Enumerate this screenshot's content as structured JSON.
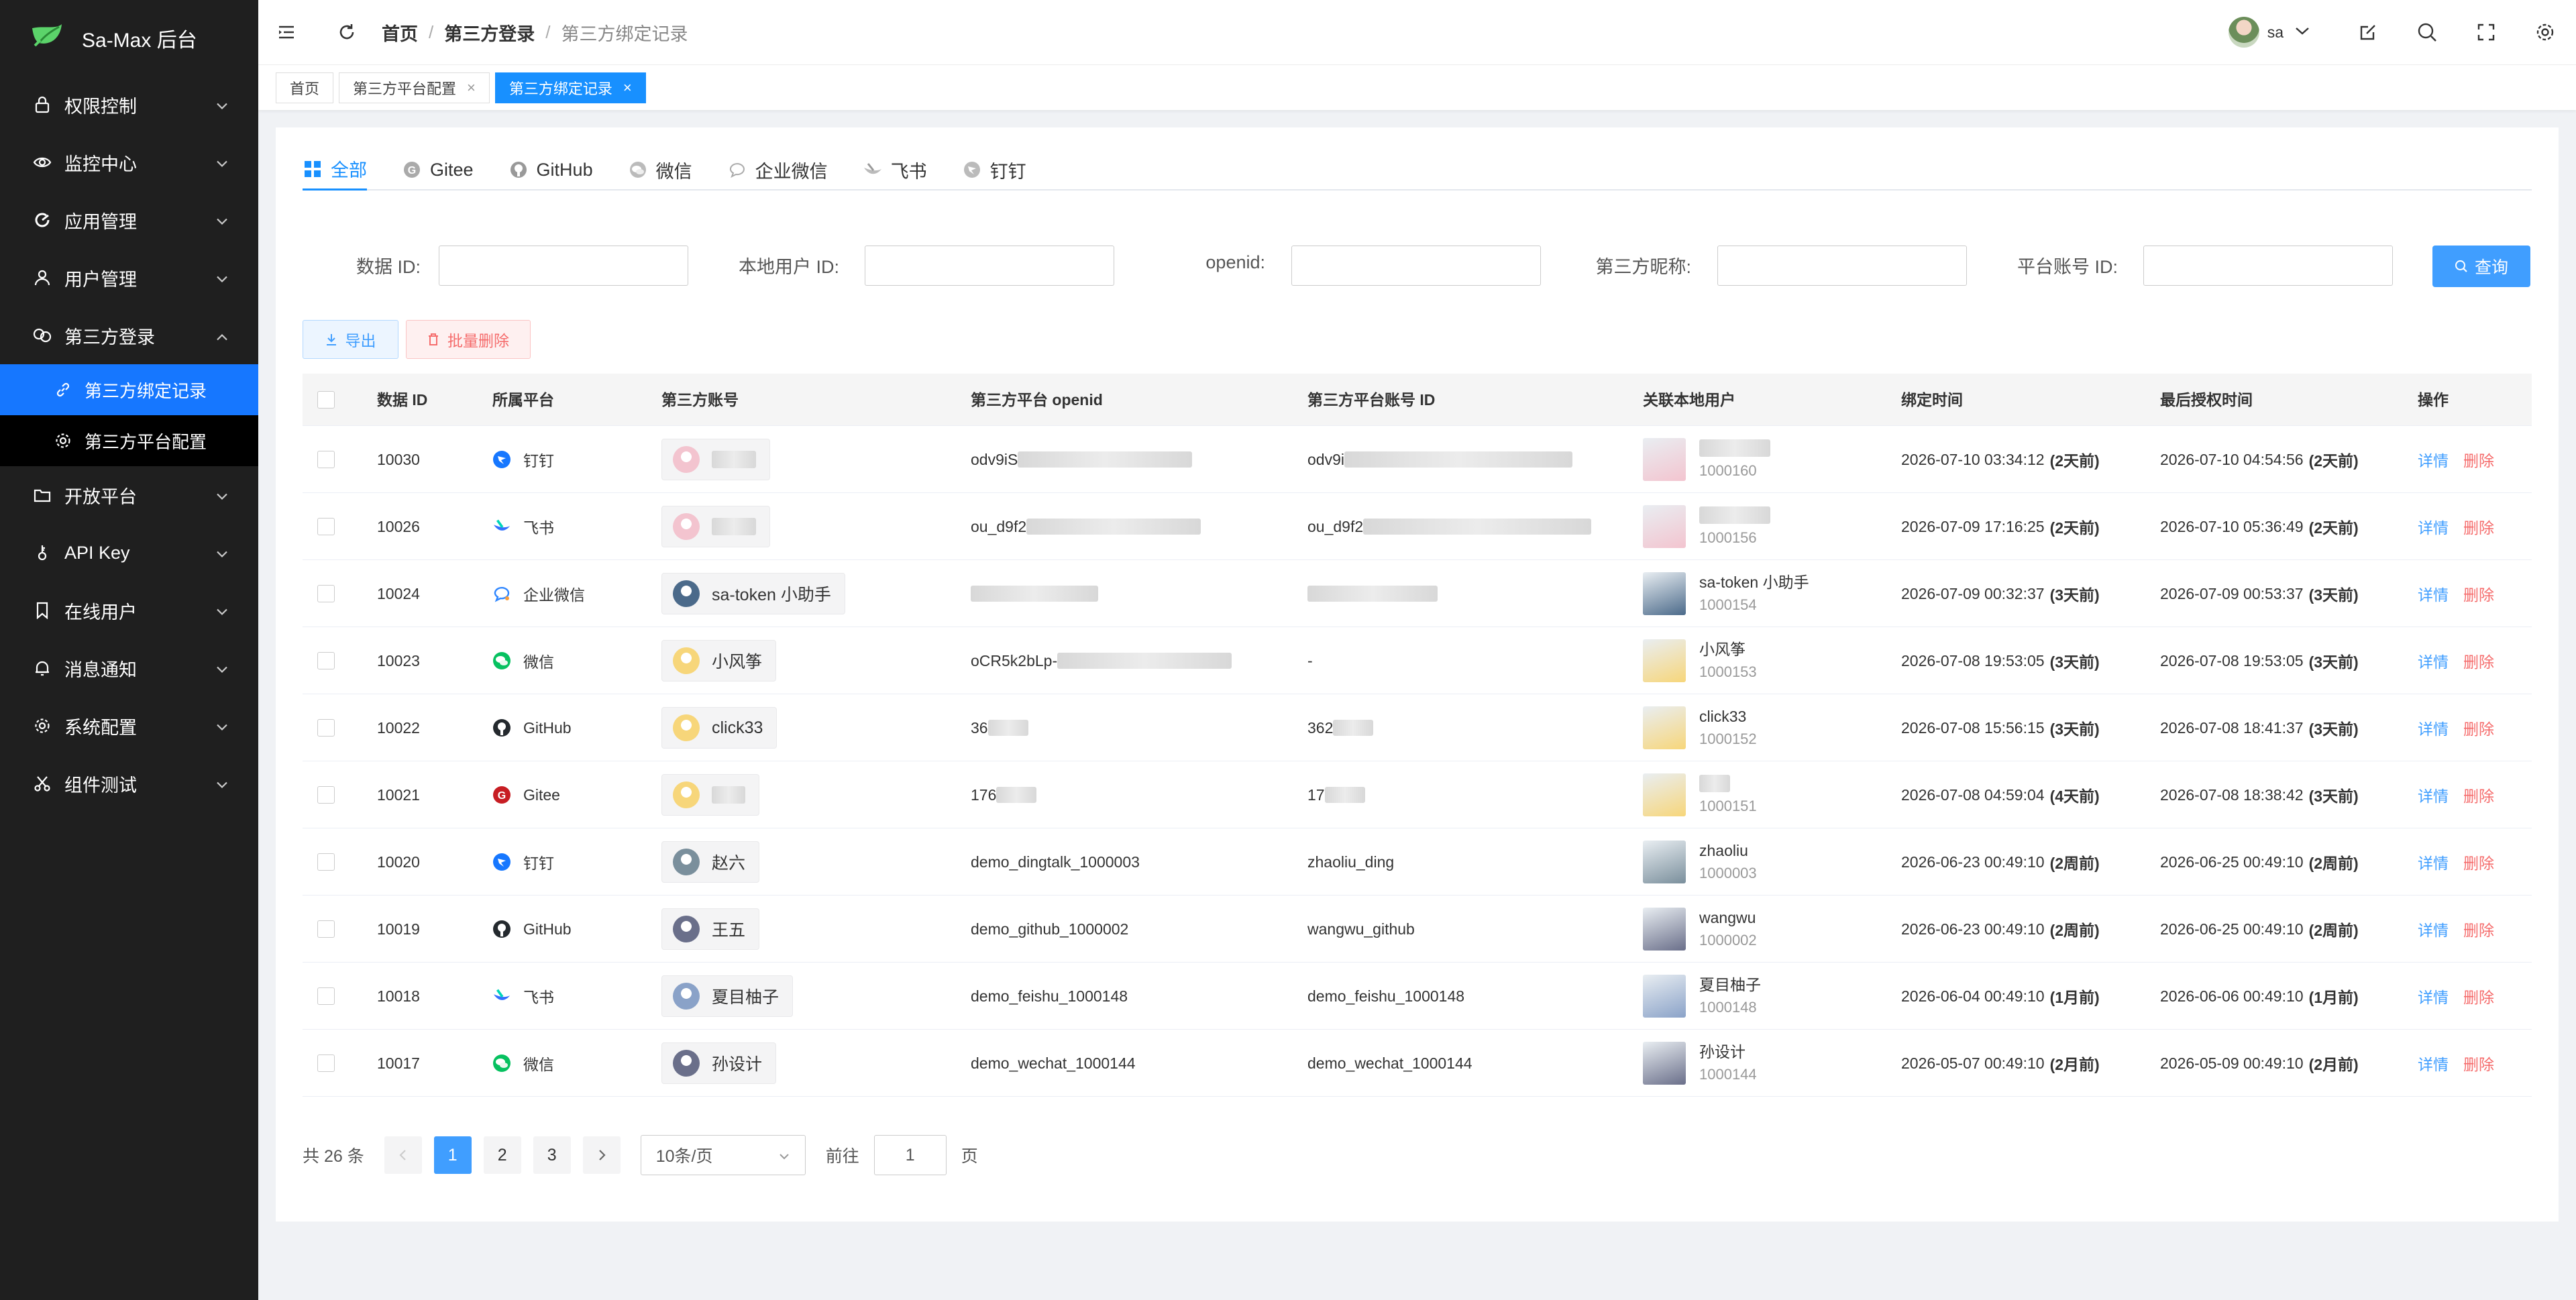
{
  "app": {
    "title": "Sa-Max 后台"
  },
  "sidebar": {
    "items": [
      {
        "label": "权限控制",
        "icon": "lock-icon"
      },
      {
        "label": "监控中心",
        "icon": "eye-icon"
      },
      {
        "label": "应用管理",
        "icon": "refresh-circle-icon"
      },
      {
        "label": "用户管理",
        "icon": "user-icon"
      },
      {
        "label": "第三方登录",
        "icon": "link-icon",
        "expanded": true
      },
      {
        "label": "开放平台",
        "icon": "folder-icon"
      },
      {
        "label": "API Key",
        "icon": "key-icon"
      },
      {
        "label": "在线用户",
        "icon": "bookmark-icon"
      },
      {
        "label": "消息通知",
        "icon": "bell-icon"
      },
      {
        "label": "系统配置",
        "icon": "gear-icon"
      },
      {
        "label": "组件测试",
        "icon": "scissors-icon"
      }
    ],
    "sub_items": [
      {
        "label": "第三方绑定记录",
        "icon": "link-icon",
        "active": true
      },
      {
        "label": "第三方平台配置",
        "icon": "gear-icon",
        "active": false
      }
    ]
  },
  "header": {
    "breadcrumb": [
      "首页",
      "第三方登录",
      "第三方绑定记录"
    ],
    "user_name": "sa"
  },
  "tags": [
    {
      "label": "首页",
      "closable": false,
      "active": false
    },
    {
      "label": "第三方平台配置",
      "closable": true,
      "active": false
    },
    {
      "label": "第三方绑定记录",
      "closable": true,
      "active": true
    }
  ],
  "tabs": [
    {
      "label": "全部",
      "icon": "grid-icon",
      "active": true
    },
    {
      "label": "Gitee",
      "icon": "gitee-icon"
    },
    {
      "label": "GitHub",
      "icon": "github-icon"
    },
    {
      "label": "微信",
      "icon": "wechat-icon"
    },
    {
      "label": "企业微信",
      "icon": "wecom-icon"
    },
    {
      "label": "飞书",
      "icon": "feishu-icon"
    },
    {
      "label": "钉钉",
      "icon": "dingtalk-icon"
    }
  ],
  "filters": [
    {
      "label": "数据 ID:",
      "value": ""
    },
    {
      "label": "本地用户 ID:",
      "value": ""
    },
    {
      "label": "openid:",
      "value": ""
    },
    {
      "label": "第三方昵称:",
      "value": ""
    },
    {
      "label": "平台账号 ID:",
      "value": ""
    }
  ],
  "buttons": {
    "search": "查询",
    "export": "导出",
    "batch_delete": "批量删除"
  },
  "table": {
    "headers": [
      "数据 ID",
      "所属平台",
      "第三方账号",
      "第三方平台 openid",
      "第三方平台账号 ID",
      "关联本地用户",
      "绑定时间",
      "最后授权时间",
      "操作"
    ],
    "rows": [
      {
        "id": "10030",
        "platform": "钉钉",
        "platform_icon": "dingtalk",
        "account": "",
        "account_blur": true,
        "openid": "odv9iS",
        "openid_blur": true,
        "account_id": "odv9i",
        "account_id_blur": true,
        "local_name": "",
        "local_name_blur": true,
        "local_id": "1000160",
        "bind_time": "2026-07-10 03:34:12",
        "bind_ago": "(2天前)",
        "auth_time": "2026-07-10 04:54:56",
        "auth_ago": "(2天前)"
      },
      {
        "id": "10026",
        "platform": "飞书",
        "platform_icon": "feishu",
        "account": "",
        "account_blur": true,
        "openid": "ou_d9f2",
        "openid_blur": true,
        "account_id": "ou_d9f2",
        "account_id_blur": true,
        "local_name": "",
        "local_name_blur": true,
        "local_id": "1000156",
        "bind_time": "2026-07-09 17:16:25",
        "bind_ago": "(2天前)",
        "auth_time": "2026-07-10 05:36:49",
        "auth_ago": "(2天前)"
      },
      {
        "id": "10024",
        "platform": "企业微信",
        "platform_icon": "wecom",
        "account": "sa-token 小助手",
        "account_blur": false,
        "openid": "",
        "openid_blur": true,
        "account_id": "",
        "account_id_blur": true,
        "local_name": "sa-token 小助手",
        "local_name_blur": false,
        "local_id": "1000154",
        "bind_time": "2026-07-09 00:32:37",
        "bind_ago": "(3天前)",
        "auth_time": "2026-07-09 00:53:37",
        "auth_ago": "(3天前)"
      },
      {
        "id": "10023",
        "platform": "微信",
        "platform_icon": "wechat",
        "account": "小风筝",
        "account_blur": false,
        "openid": "oCR5k2bLp-",
        "openid_blur": true,
        "account_id": "-",
        "account_id_blur": false,
        "local_name": "小风筝",
        "local_name_blur": false,
        "local_id": "1000153",
        "bind_time": "2026-07-08 19:53:05",
        "bind_ago": "(3天前)",
        "auth_time": "2026-07-08 19:53:05",
        "auth_ago": "(3天前)"
      },
      {
        "id": "10022",
        "platform": "GitHub",
        "platform_icon": "github",
        "account": "click33",
        "account_blur": false,
        "openid": "36",
        "openid_blur": true,
        "account_id": "362",
        "account_id_blur": true,
        "local_name": "click33",
        "local_name_blur": false,
        "local_id": "1000152",
        "bind_time": "2026-07-08 15:56:15",
        "bind_ago": "(3天前)",
        "auth_time": "2026-07-08 18:41:37",
        "auth_ago": "(3天前)"
      },
      {
        "id": "10021",
        "platform": "Gitee",
        "platform_icon": "gitee",
        "account": "",
        "account_blur": true,
        "openid": "176",
        "openid_blur": true,
        "account_id": "17",
        "account_id_blur": true,
        "local_name": "",
        "local_name_blur": true,
        "local_id": "1000151",
        "bind_time": "2026-07-08 04:59:04",
        "bind_ago": "(4天前)",
        "auth_time": "2026-07-08 18:38:42",
        "auth_ago": "(3天前)"
      },
      {
        "id": "10020",
        "platform": "钉钉",
        "platform_icon": "dingtalk",
        "account": "赵六",
        "account_blur": false,
        "openid": "demo_dingtalk_1000003",
        "openid_blur": false,
        "account_id": "zhaoliu_ding",
        "account_id_blur": false,
        "local_name": "zhaoliu",
        "local_name_blur": false,
        "local_id": "1000003",
        "bind_time": "2026-06-23 00:49:10",
        "bind_ago": "(2周前)",
        "auth_time": "2026-06-25 00:49:10",
        "auth_ago": "(2周前)"
      },
      {
        "id": "10019",
        "platform": "GitHub",
        "platform_icon": "github",
        "account": "王五",
        "account_blur": false,
        "openid": "demo_github_1000002",
        "openid_blur": false,
        "account_id": "wangwu_github",
        "account_id_blur": false,
        "local_name": "wangwu",
        "local_name_blur": false,
        "local_id": "1000002",
        "bind_time": "2026-06-23 00:49:10",
        "bind_ago": "(2周前)",
        "auth_time": "2026-06-25 00:49:10",
        "auth_ago": "(2周前)"
      },
      {
        "id": "10018",
        "platform": "飞书",
        "platform_icon": "feishu",
        "account": "夏目柚子",
        "account_blur": false,
        "openid": "demo_feishu_1000148",
        "openid_blur": false,
        "account_id": "demo_feishu_1000148",
        "account_id_blur": false,
        "local_name": "夏目柚子",
        "local_name_blur": false,
        "local_id": "1000148",
        "bind_time": "2026-06-04 00:49:10",
        "bind_ago": "(1月前)",
        "auth_time": "2026-06-06 00:49:10",
        "auth_ago": "(1月前)"
      },
      {
        "id": "10017",
        "platform": "微信",
        "platform_icon": "wechat",
        "account": "孙设计",
        "account_blur": false,
        "openid": "demo_wechat_1000144",
        "openid_blur": false,
        "account_id": "demo_wechat_1000144",
        "account_id_blur": false,
        "local_name": "孙设计",
        "local_name_blur": false,
        "local_id": "1000144",
        "bind_time": "2026-05-07 00:49:10",
        "bind_ago": "(2月前)",
        "auth_time": "2026-05-09 00:49:10",
        "auth_ago": "(2月前)"
      }
    ],
    "actions": {
      "detail": "详情",
      "delete": "删除"
    }
  },
  "pagination": {
    "total_text": "共 26 条",
    "pages": [
      "1",
      "2",
      "3"
    ],
    "current": "1",
    "page_size": "10条/页",
    "goto_prefix": "前往",
    "goto_value": "1",
    "goto_suffix": "页"
  },
  "colors": {
    "primary": "#1890ff",
    "sidebar_bg": "#1f1f1f",
    "danger": "#f56c6c",
    "dingtalk": "#1677ff",
    "wechat": "#07c160",
    "gitee": "#c71d23",
    "github": "#24292e",
    "feishu": "#3370ff"
  }
}
